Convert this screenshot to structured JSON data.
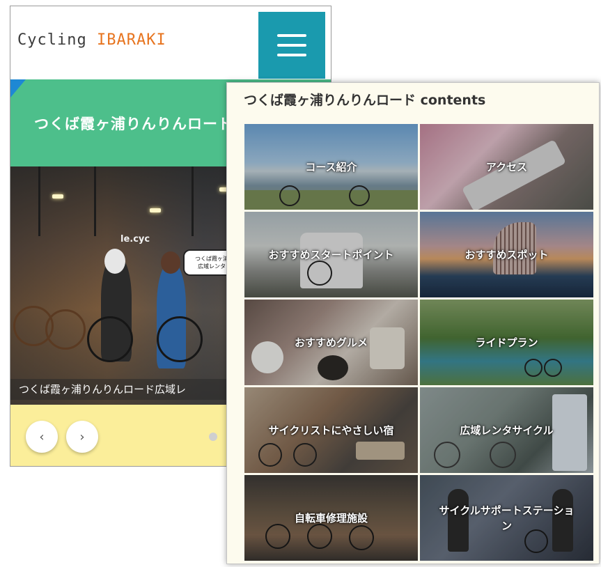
{
  "back_screen": {
    "logo_prefix": "Cycling ",
    "logo_accent": "IBARAKI",
    "menu_icon": "hamburger-menu-icon",
    "banner_title": "つくば霞ヶ浦りんりんロード",
    "photo": {
      "sign_text": "le.cyc",
      "bubble_line1": "つくば霞ヶ浦",
      "bubble_line2": "広域レンタ",
      "caption": "つくば霞ヶ浦りんりんロード広域レ"
    },
    "carousel": {
      "prev_label": "‹",
      "next_label": "›"
    },
    "colors": {
      "menu_bg": "#1a9aae",
      "banner_bg": "#4dbf8b",
      "controls_bg": "#fbee9a",
      "logo_accent": "#e7741f"
    }
  },
  "contents_panel": {
    "title": "つくば霞ヶ浦りんりんロード contents",
    "tiles": [
      {
        "label": "コース紹介"
      },
      {
        "label": "アクセス"
      },
      {
        "label": "おすすめスタートポイント"
      },
      {
        "label": "おすすめスポット"
      },
      {
        "label": "おすすめグルメ"
      },
      {
        "label": "ライドプラン"
      },
      {
        "label": "サイクリストにやさしい宿"
      },
      {
        "label": "広域レンタサイクル"
      },
      {
        "label": "自転車修理施設"
      },
      {
        "label": "サイクルサポートステーション"
      }
    ]
  }
}
